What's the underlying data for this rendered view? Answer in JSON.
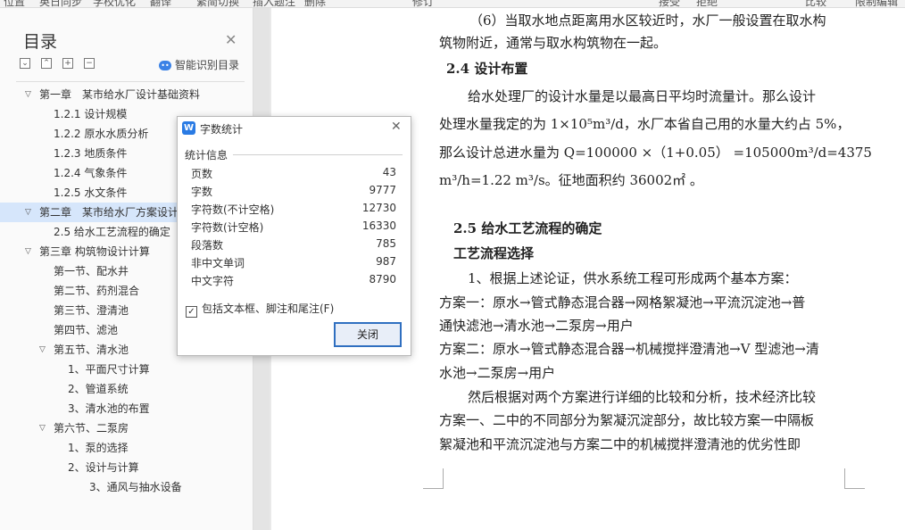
{
  "toolbar": {
    "items": [
      "位置",
      "英日同步",
      "学校优化",
      "翻译",
      "繁简切换",
      "插入题注",
      "删除",
      "修订",
      "接受",
      "拒绝",
      "比较",
      "限制编辑"
    ]
  },
  "sidebar": {
    "title": "目录",
    "smart_label": "智能识别目录",
    "items": [
      {
        "label": "第一章　某市给水厂设计基础资料",
        "level": 0,
        "expanded": true,
        "selected": false
      },
      {
        "label": "1.2.1 设计规模",
        "level": 1,
        "expanded": null,
        "selected": false
      },
      {
        "label": "1.2.2 原水水质分析",
        "level": 1,
        "expanded": null,
        "selected": false
      },
      {
        "label": "1.2.3 地质条件",
        "level": 1,
        "expanded": null,
        "selected": false
      },
      {
        "label": "1.2.4 气象条件",
        "level": 1,
        "expanded": null,
        "selected": false
      },
      {
        "label": "1.2.5 水文条件",
        "level": 1,
        "expanded": null,
        "selected": false
      },
      {
        "label": "第二章　某市给水厂方案设计",
        "level": 0,
        "expanded": true,
        "selected": true
      },
      {
        "label": "2.5 给水工艺流程的确定",
        "level": 1,
        "expanded": null,
        "selected": false
      },
      {
        "label": "第三章 构筑物设计计算",
        "level": 0,
        "expanded": true,
        "selected": false
      },
      {
        "label": "第一节、配水井",
        "level": 1,
        "expanded": null,
        "selected": false
      },
      {
        "label": "第二节、药剂混合",
        "level": 1,
        "expanded": null,
        "selected": false
      },
      {
        "label": "第三节、澄清池",
        "level": 1,
        "expanded": null,
        "selected": false
      },
      {
        "label": "第四节、滤池",
        "level": 1,
        "expanded": null,
        "selected": false
      },
      {
        "label": "第五节、清水池",
        "level": 1,
        "expanded": true,
        "selected": false
      },
      {
        "label": "1、平面尺寸计算",
        "level": 2,
        "expanded": null,
        "selected": false
      },
      {
        "label": "2、管道系统",
        "level": 2,
        "expanded": null,
        "selected": false
      },
      {
        "label": "3、清水池的布置",
        "level": 2,
        "expanded": null,
        "selected": false
      },
      {
        "label": "第六节、二泵房",
        "level": 1,
        "expanded": true,
        "selected": false
      },
      {
        "label": "1、泵的选择",
        "level": 2,
        "expanded": null,
        "selected": false
      },
      {
        "label": "2、设计与计算",
        "level": 2,
        "expanded": null,
        "selected": false
      },
      {
        "label": "3、通风与抽水设备",
        "level": 3,
        "expanded": null,
        "selected": false
      }
    ]
  },
  "document": {
    "top_partial": "（6）当取水地点距离用水区较近时，水厂一般设置在取水构",
    "line1": "筑物附近，通常与取水构筑物在一起。",
    "heading_24": "2.4 设计布置",
    "para1_l1": "给水处理厂的设计水量是以最高日平均时流量计。那么设计",
    "para1_l2": "处理水量我定的为 1×10⁵m³/d，水厂本省自己用的水量大约占 5%，",
    "para1_l3": "那么设计总进水量为 Q=100000 ×（1+0.05） =105000m³/d=4375",
    "para1_l4": "m³/h=1.22 m³/s。征地面积约 36002㎡ 。",
    "heading_25": "2.5 给水工艺流程的确定",
    "heading_gy": "工艺流程选择",
    "para2_l1": "1、根据上述论证，供水系统工程可形成两个基本方案：",
    "para2_l2": "方案一：原水→管式静态混合器→网格絮凝池→平流沉淀池→普",
    "para2_l3": "通快滤池→清水池→二泵房→用户",
    "para2_l4": "方案二：原水→管式静态混合器→机械搅拌澄清池→V 型滤池→清",
    "para2_l5": "水池→二泵房→用户",
    "para3_l1": "然后根据对两个方案进行详细的比较和分析，技术经济比较",
    "para3_l2": "方案一、二中的不同部分为絮凝沉淀部分，故比较方案一中隔板",
    "para3_l3": "絮凝池和平流沉淀池与方案二中的机械搅拌澄清池的优劣性即"
  },
  "dialog": {
    "logo": "W",
    "title": "字数统计",
    "section": "统计信息",
    "stats": [
      {
        "label": "页数",
        "value": "43"
      },
      {
        "label": "字数",
        "value": "9777"
      },
      {
        "label": "字符数(不计空格)",
        "value": "12730"
      },
      {
        "label": "字符数(计空格)",
        "value": "16330"
      },
      {
        "label": "段落数",
        "value": "785"
      },
      {
        "label": "非中文单词",
        "value": "987"
      },
      {
        "label": "中文字符",
        "value": "8790"
      }
    ],
    "checkbox_label": "包括文本框、脚注和尾注(F)",
    "checkbox_checked": true,
    "close_button": "关闭"
  },
  "colors": {
    "selected_row": "#d6e6fb",
    "accent": "#2a7be4",
    "button_border": "#2f6fc0"
  }
}
